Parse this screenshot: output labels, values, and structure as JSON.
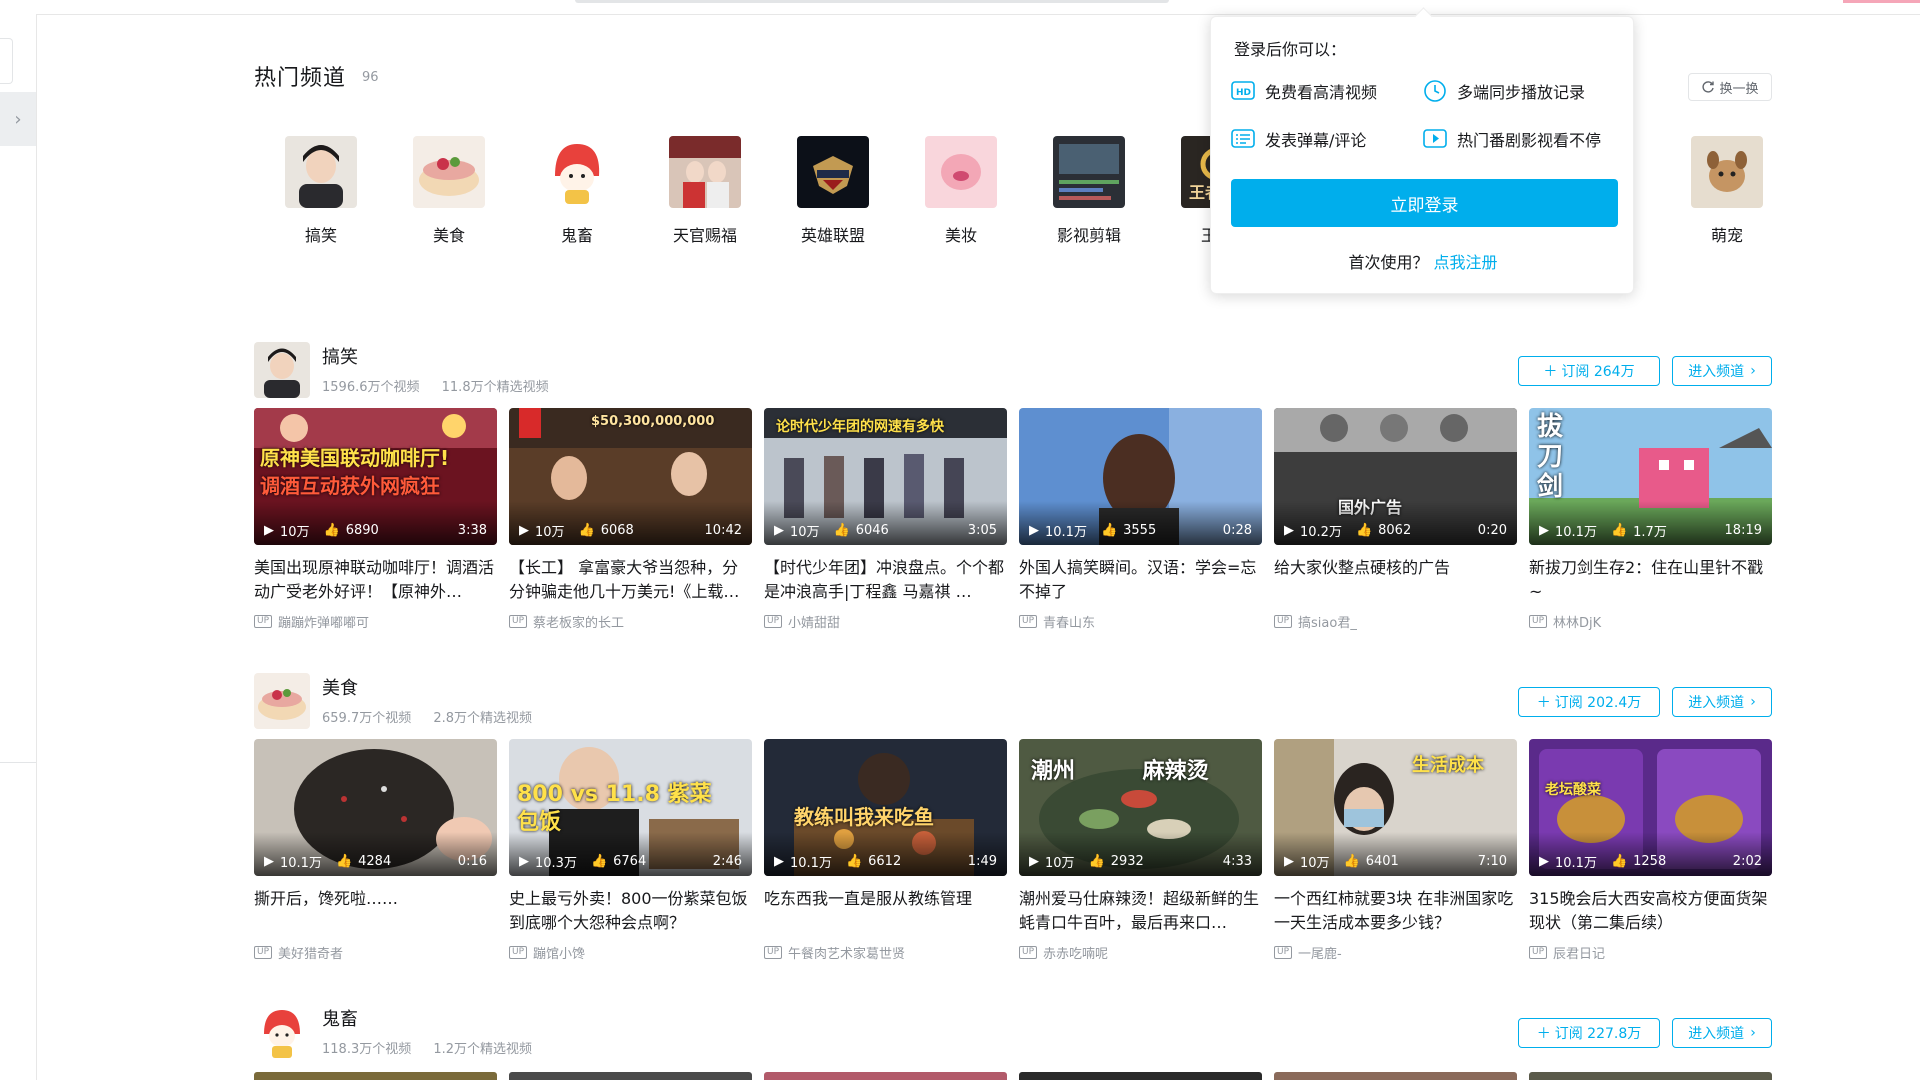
{
  "hot": {
    "title": "热门频道",
    "count": "96",
    "refresh_label": "换一换"
  },
  "channels": [
    {
      "label": "搞笑"
    },
    {
      "label": "美食"
    },
    {
      "label": "鬼畜"
    },
    {
      "label": "天官赐福"
    },
    {
      "label": "英雄联盟"
    },
    {
      "label": "美妆"
    },
    {
      "label": "影视剪辑"
    },
    {
      "label": "王者"
    },
    {
      "label": "萌宠"
    }
  ],
  "sections": [
    {
      "name": "搞笑",
      "videos_count": "1596.6万个视频",
      "featured_count": "11.8万个精选视频",
      "subscribe_label": "订阅 264万",
      "enter_label": "进入频道",
      "cards": [
        {
          "views": "10万",
          "likes": "6890",
          "duration": "3:38",
          "title": "美国出现原神联动咖啡厅！调酒活动广受老外好评！【原神外…",
          "author": "蹦蹦炸弹嘟嘟可",
          "overlay": "原神美国联动咖啡厅!"
        },
        {
          "views": "10万",
          "likes": "6068",
          "duration": "10:42",
          "title": "【长工】 拿富豪大爷当怨种，分分钟骗走他几十万美元!《上载…",
          "author": "蔡老板家的长工",
          "overlay": "$50,300,000,000"
        },
        {
          "views": "10万",
          "likes": "6046",
          "duration": "3:05",
          "title": "【时代少年团】冲浪盘点。个个都是冲浪高手|丁程鑫 马嘉祺 …",
          "author": "小婧甜甜",
          "overlay": "论时代少年团的网速有多快"
        },
        {
          "views": "10.1万",
          "likes": "3555",
          "duration": "0:28",
          "title": "外国人搞笑瞬间。汉语：学会=忘不掉了",
          "author": "青春山东",
          "overlay": ""
        },
        {
          "views": "10.2万",
          "likes": "8062",
          "duration": "0:20",
          "title": "给大家伙整点硬核的广告",
          "author": "搞siao君_",
          "overlay": "国外广告"
        },
        {
          "views": "10.1万",
          "likes": "1.7万",
          "duration": "18:19",
          "title": "新拔刀剑生存2：住在山里针不戳~",
          "author": "林林DjK",
          "overlay": "拔刀剑"
        }
      ]
    },
    {
      "name": "美食",
      "videos_count": "659.7万个视频",
      "featured_count": "2.8万个精选视频",
      "subscribe_label": "订阅 202.4万",
      "enter_label": "进入频道",
      "cards": [
        {
          "views": "10.1万",
          "likes": "4284",
          "duration": "0:16",
          "title": "撕开后，馋死啦……",
          "author": "美好猎奇者",
          "overlay": ""
        },
        {
          "views": "10.3万",
          "likes": "6764",
          "duration": "2:46",
          "title": "史上最亏外卖！800一份紫菜包饭到底哪个大怨种会点啊？",
          "author": "蹦馆小馋",
          "overlay": "800 vs 11.8 紫菜包饭"
        },
        {
          "views": "10.1万",
          "likes": "6612",
          "duration": "1:49",
          "title": "吃东西我一直是服从教练管理",
          "author": "午餐肉艺术家葛世贤",
          "overlay": "教练叫我来吃鱼"
        },
        {
          "views": "10万",
          "likes": "2932",
          "duration": "4:33",
          "title": "潮州爱马仕麻辣烫！超级新鲜的生蚝青口牛百叶，最后再来口…",
          "author": "赤赤吃喃呢",
          "overlay": "潮州 麻辣烫"
        },
        {
          "views": "10万",
          "likes": "6401",
          "duration": "7:10",
          "title": "一个西红柿就要3块 在非洲国家吃一天生活成本要多少钱？",
          "author": "一尾鹿-",
          "overlay": "生活成本"
        },
        {
          "views": "10.1万",
          "likes": "1258",
          "duration": "2:02",
          "title": "315晚会后大西安高校方便面货架现状（第二集后续）",
          "author": "辰君日记",
          "overlay": "老坛酸菜"
        }
      ]
    },
    {
      "name": "鬼畜",
      "videos_count": "118.3万个视频",
      "featured_count": "1.2万个精选视频",
      "subscribe_label": "订阅 227.8万",
      "enter_label": "进入频道",
      "cards": []
    }
  ],
  "login_popup": {
    "heading": "登录后你可以：",
    "benefits": [
      {
        "icon": "hd-icon",
        "label": "免费看高清视频"
      },
      {
        "icon": "clock-icon",
        "label": "多端同步播放记录"
      },
      {
        "icon": "danmaku-icon",
        "label": "发表弹幕/评论"
      },
      {
        "icon": "play-icon",
        "label": "热门番剧影视看不停"
      }
    ],
    "login_button": "立即登录",
    "first_use": "首次使用？",
    "register_link": "点我注册"
  },
  "colors": {
    "accent": "#00aeec",
    "text": "#18191c",
    "muted": "#9499a0"
  }
}
